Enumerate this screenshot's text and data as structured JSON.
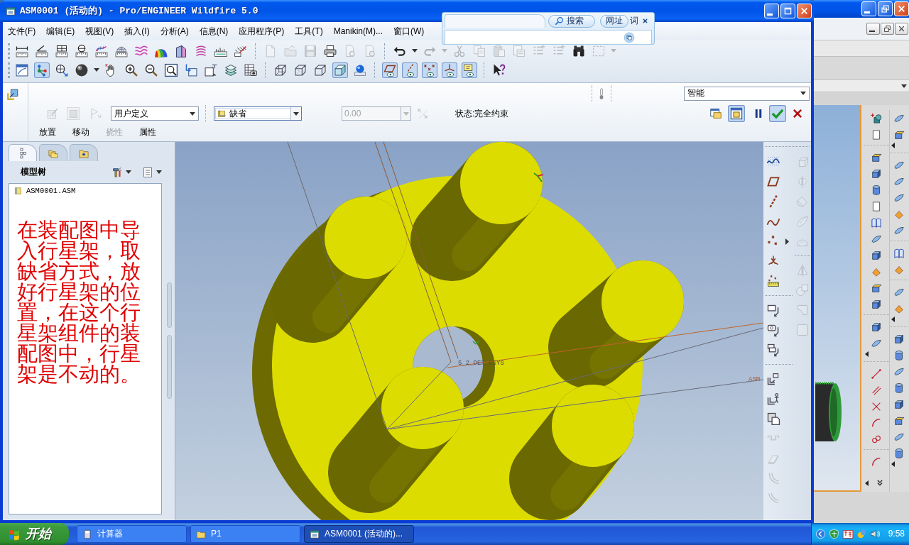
{
  "window": {
    "title": "ASM0001 (活动的) - Pro/ENGINEER Wildfire 5.0"
  },
  "menu": [
    "文件(F)",
    "编辑(E)",
    "视图(V)",
    "插入(I)",
    "分析(A)",
    "信息(N)",
    "应用程序(P)",
    "工具(T)",
    "Manikin(M)...",
    "窗口(W)"
  ],
  "toolbar_row_1": [
    {
      "disabled": false
    },
    {
      "disabled": false
    },
    {
      "disabled": false
    },
    {
      "disabled": false
    },
    {
      "disabled": false
    },
    {
      "disabled": false
    },
    {
      "disabled": false
    },
    {
      "disabled": false
    },
    {
      "disabled": false
    },
    {
      "disabled": false
    },
    {
      "disabled": false
    },
    {
      "disabled": false
    },
    {
      "disabled": true
    },
    {
      "disabled": true
    },
    {
      "disabled": true
    },
    {
      "disabled": false
    },
    {
      "disabled": true
    },
    {
      "disabled": true
    },
    {
      "disabled": false
    },
    {
      "disabled": true
    },
    {
      "disabled": true
    },
    {
      "disabled": true
    },
    {
      "disabled": true
    },
    {
      "disabled": true
    },
    {
      "disabled": true
    },
    {
      "disabled": true
    },
    {
      "disabled": false
    },
    {
      "disabled": true
    }
  ],
  "toolbar_row_2": [
    {
      "on": false
    },
    {
      "on": true
    },
    {
      "on": false
    },
    {
      "on": false
    },
    {
      "on": false
    },
    {
      "on": false
    },
    {
      "on": false
    },
    {
      "on": false
    },
    {
      "on": false
    },
    {
      "on": false
    },
    {
      "on": false
    },
    {
      "on": false
    },
    {
      "on": false
    },
    {
      "on": false
    },
    {
      "on": false
    },
    {
      "on": true
    },
    {
      "on": false
    },
    {
      "on": true
    },
    {
      "on": true
    },
    {
      "on": true
    },
    {
      "on": true
    },
    {
      "on": true
    },
    {
      "on": false
    }
  ],
  "dashboard": {
    "tools": [
      {
        "disabled": true
      },
      {
        "disabled": true
      },
      {
        "disabled": true
      }
    ],
    "constraint_set": "用户定义",
    "constraint": "缺省",
    "offset": {
      "value": "0.00",
      "disabled": true
    },
    "status": "状态:完全约束",
    "filter": "智能",
    "actions": [
      {
        "on": false
      },
      {
        "on": true
      },
      {
        "on": false
      },
      {
        "on": true
      },
      {
        "on": false
      }
    ],
    "tabs": [
      {
        "label": "放置",
        "disabled": false
      },
      {
        "label": "移动",
        "disabled": false
      },
      {
        "label": "挠性",
        "disabled": true
      },
      {
        "label": "属性",
        "disabled": false
      }
    ]
  },
  "model_tree": {
    "tabs": [
      {
        "selected": true
      },
      {
        "selected": false
      },
      {
        "selected": false
      }
    ],
    "title": "模型树",
    "items": [
      {
        "label": "ASM0001.ASM"
      }
    ],
    "note": "在装配图中导入行星架，取缺省方式，放好行星架的位置，在这个行星架组件的装配图中，行星架是不动的。"
  },
  "viewport": {
    "labels": [
      "5_2_DEF_CSYS",
      "ASM"
    ]
  },
  "right_toolbar": {
    "column_1": [
      {
        "disabled": false
      },
      {
        "disabled": false
      },
      {
        "disabled": false
      },
      {
        "disabled": false
      },
      {
        "disabled": false
      },
      {
        "disabled": false
      },
      {
        "disabled": false
      },
      {
        "disabled": false
      },
      {
        "disabled": false
      },
      {
        "disabled": false
      },
      {
        "disabled": false
      },
      {
        "disabled": false
      },
      {
        "disabled": false
      },
      {
        "disabled": true
      },
      {
        "disabled": true
      },
      {
        "disabled": true
      },
      {
        "disabled": true
      }
    ],
    "column_2": [
      {
        "disabled": true
      },
      {
        "disabled": true
      },
      {
        "disabled": true
      },
      {
        "disabled": true
      },
      {
        "disabled": true
      },
      {
        "disabled": true
      },
      {
        "disabled": true
      },
      {
        "disabled": true
      },
      {
        "disabled": true
      }
    ]
  },
  "search_popup": {
    "buttons": [
      "搜索",
      "网址",
      "词"
    ]
  },
  "taskbar": {
    "start": "开始",
    "tasks": [
      {
        "label": "计算器",
        "selected": false
      },
      {
        "label": "P1",
        "selected": false
      },
      {
        "label": "ASM0001 (活动的)...",
        "selected": true
      }
    ],
    "clock": "9:58"
  }
}
